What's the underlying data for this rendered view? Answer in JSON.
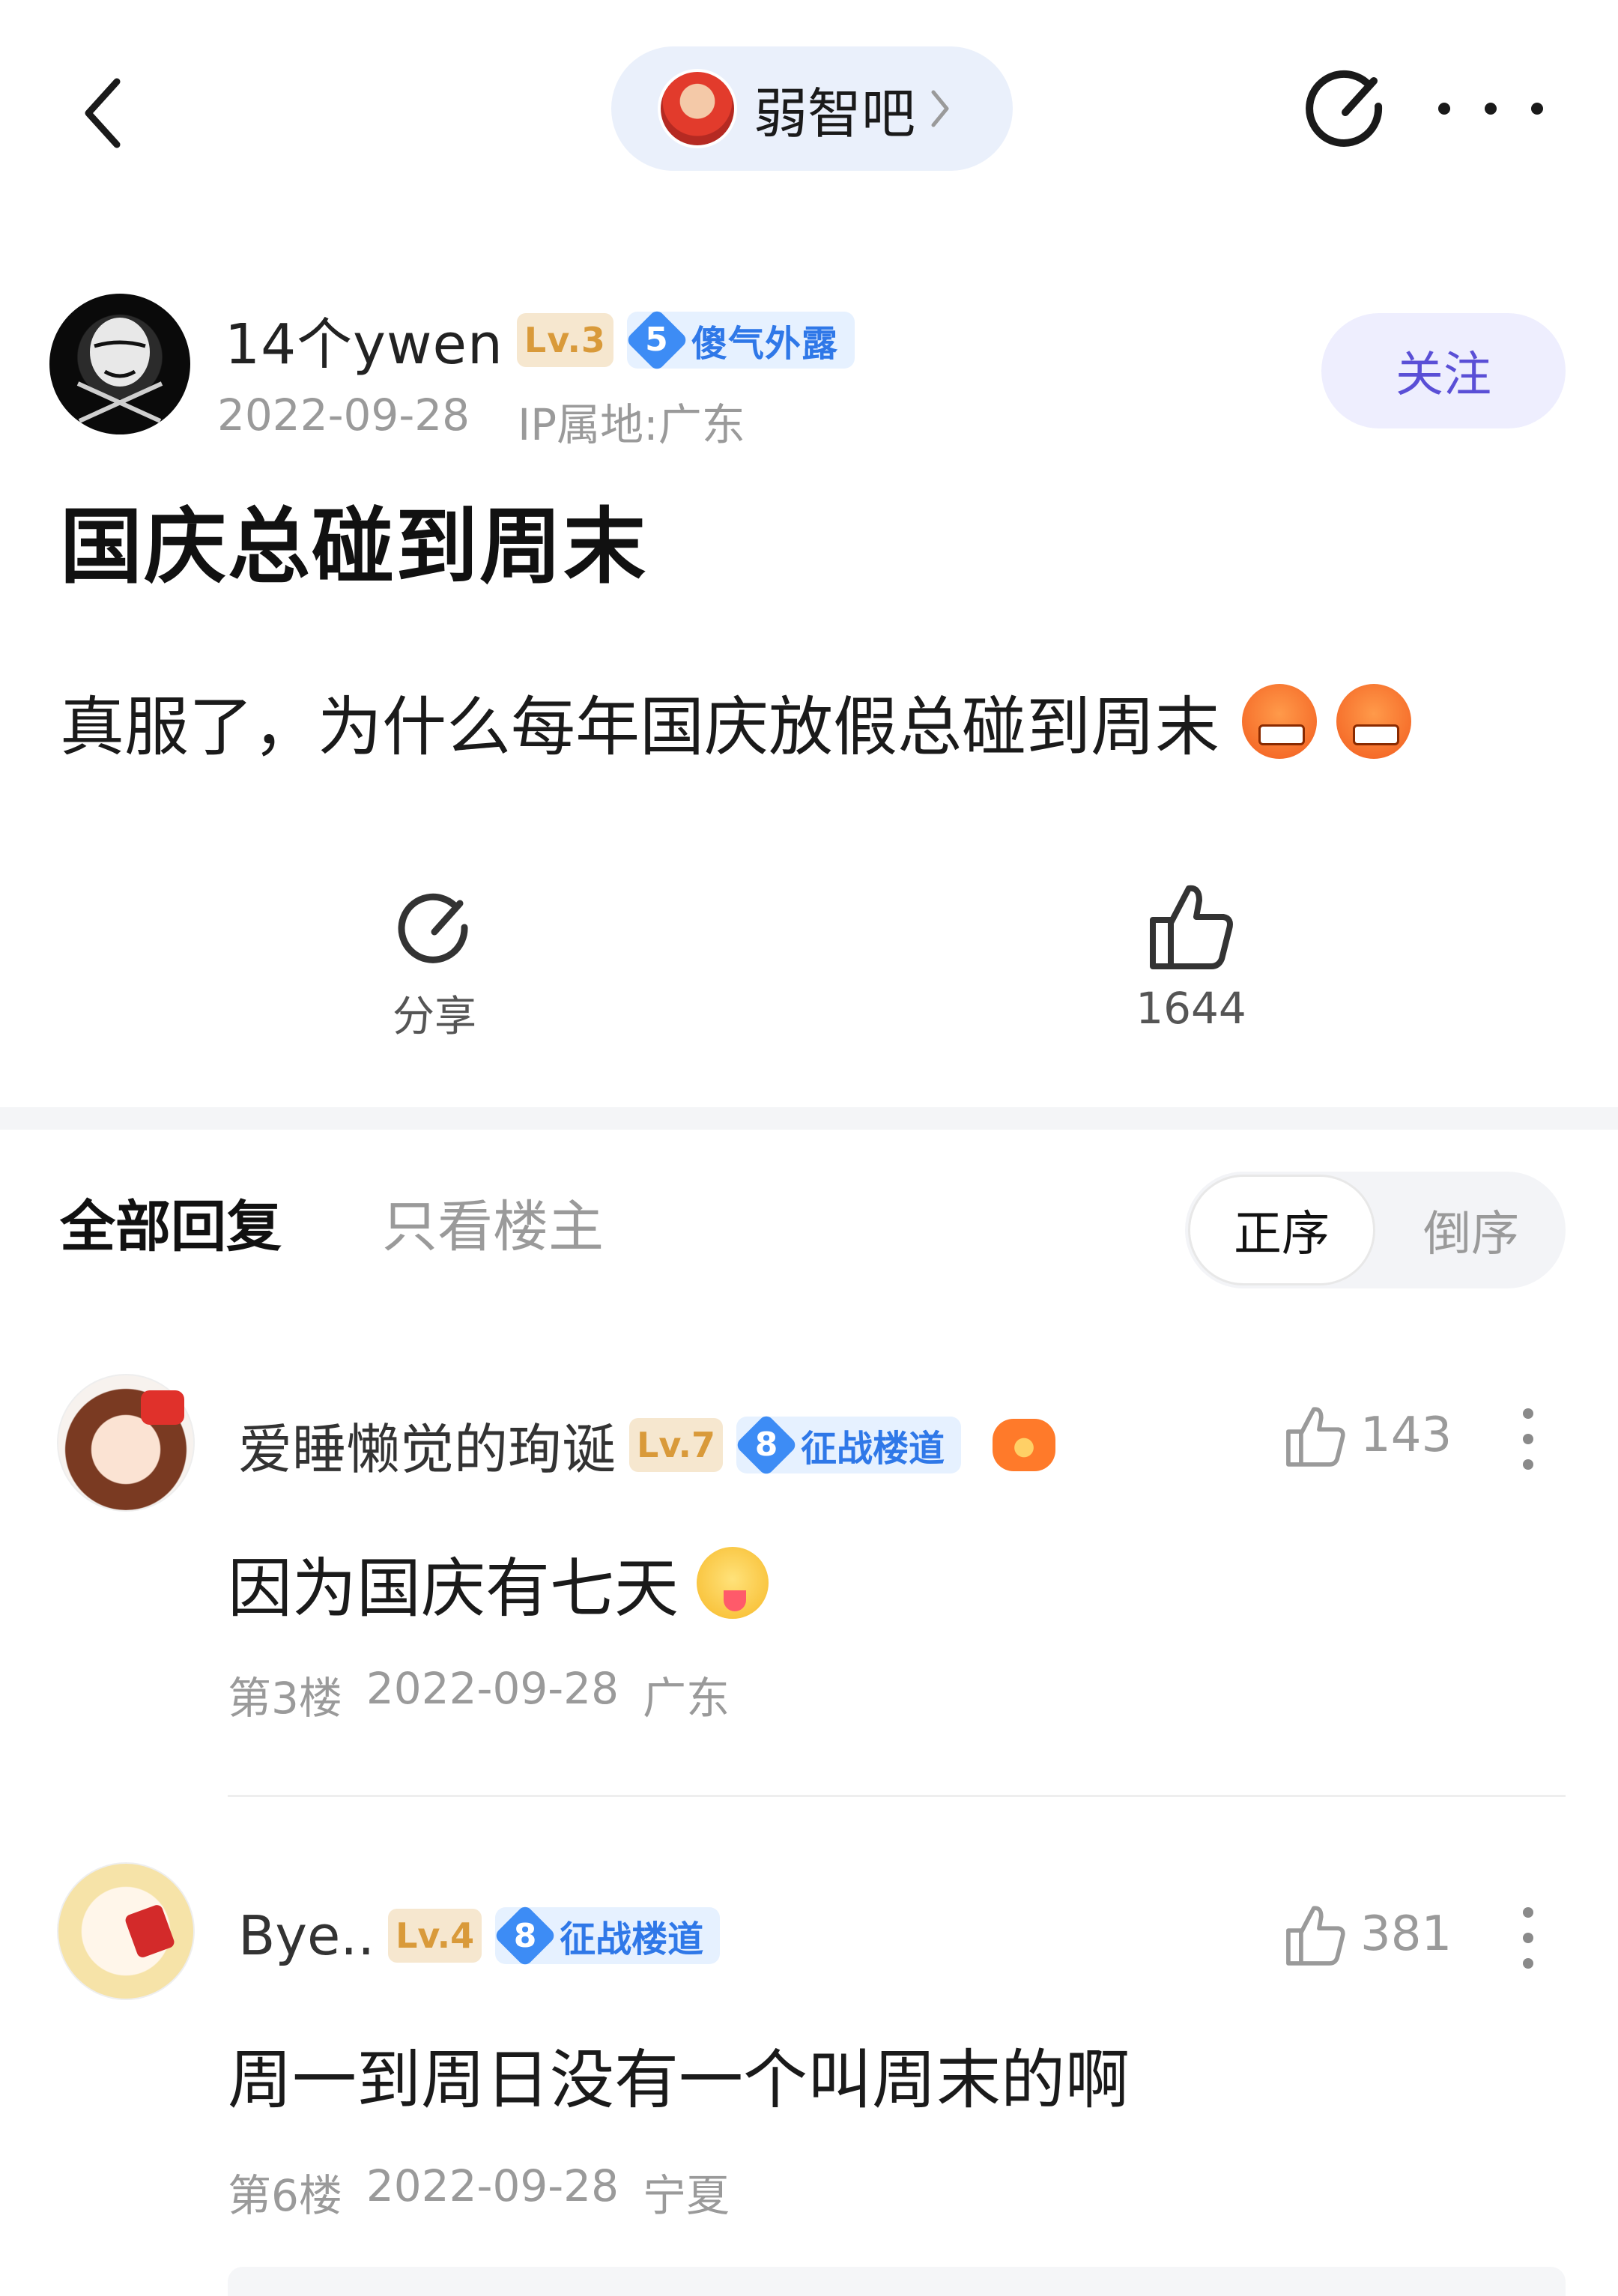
{
  "topbar": {
    "forum_name": "弱智吧"
  },
  "author": {
    "name": "14个ywen",
    "level": "Lv.3",
    "honor_level": "5",
    "honor_title": "傻气外露",
    "date": "2022-09-28",
    "ip_location": "IP属地:广东",
    "follow_label": "关注"
  },
  "post": {
    "title": "国庆总碰到周末",
    "body": "真服了，为什么每年国庆放假总碰到周末"
  },
  "actions": {
    "share_label": "分享",
    "like_count": "1644"
  },
  "reply_tabs": {
    "all_label": "全部回复",
    "owner_only_label": "只看楼主",
    "order_asc_label": "正序",
    "order_desc_label": "倒序"
  },
  "replies": [
    {
      "name": "爱睡懒觉的珣诞",
      "level": "Lv.7",
      "honor_level": "8",
      "honor_title": "征战楼道",
      "likes": "143",
      "text": "因为国庆有七天",
      "floor": "第3楼",
      "date": "2022-09-28",
      "location": "广东"
    },
    {
      "name": "Bye..",
      "level": "Lv.4",
      "honor_level": "8",
      "honor_title": "征战楼道",
      "likes": "381",
      "text": "周一到周日没有一个叫周末的啊",
      "floor": "第6楼",
      "date": "2022-09-28",
      "location": "宁夏"
    }
  ]
}
